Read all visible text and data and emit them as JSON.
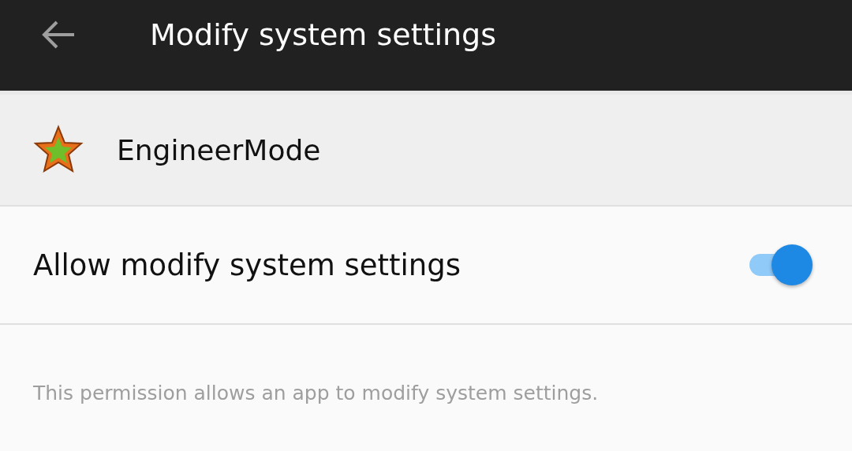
{
  "header": {
    "title": "Modify system settings"
  },
  "app": {
    "name": "EngineerMode"
  },
  "setting": {
    "label": "Allow modify system settings",
    "on": true
  },
  "description": "This permission allows an app to modify system settings."
}
